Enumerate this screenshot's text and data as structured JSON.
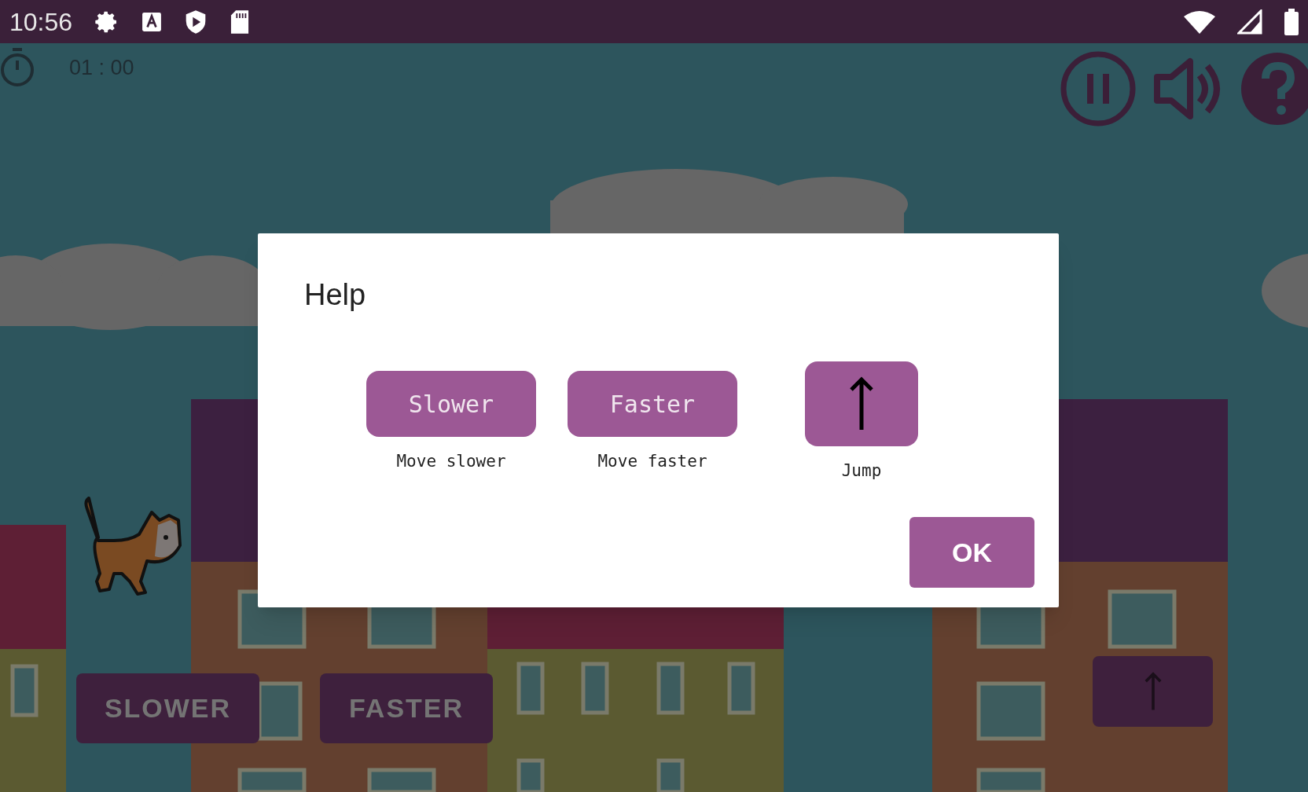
{
  "status_bar": {
    "time": "10:56"
  },
  "timer": {
    "text": "01 : 00"
  },
  "dialog": {
    "title": "Help",
    "items": [
      {
        "kind": "text",
        "label": "Slower",
        "caption": "Move slower"
      },
      {
        "kind": "text",
        "label": "Faster",
        "caption": "Move faster"
      },
      {
        "kind": "arrow",
        "caption": "Jump"
      }
    ],
    "ok": "OK"
  },
  "game_buttons": [
    {
      "kind": "text",
      "label": "SLOWER"
    },
    {
      "kind": "text",
      "label": "FASTER"
    },
    {
      "kind": "arrow"
    }
  ]
}
